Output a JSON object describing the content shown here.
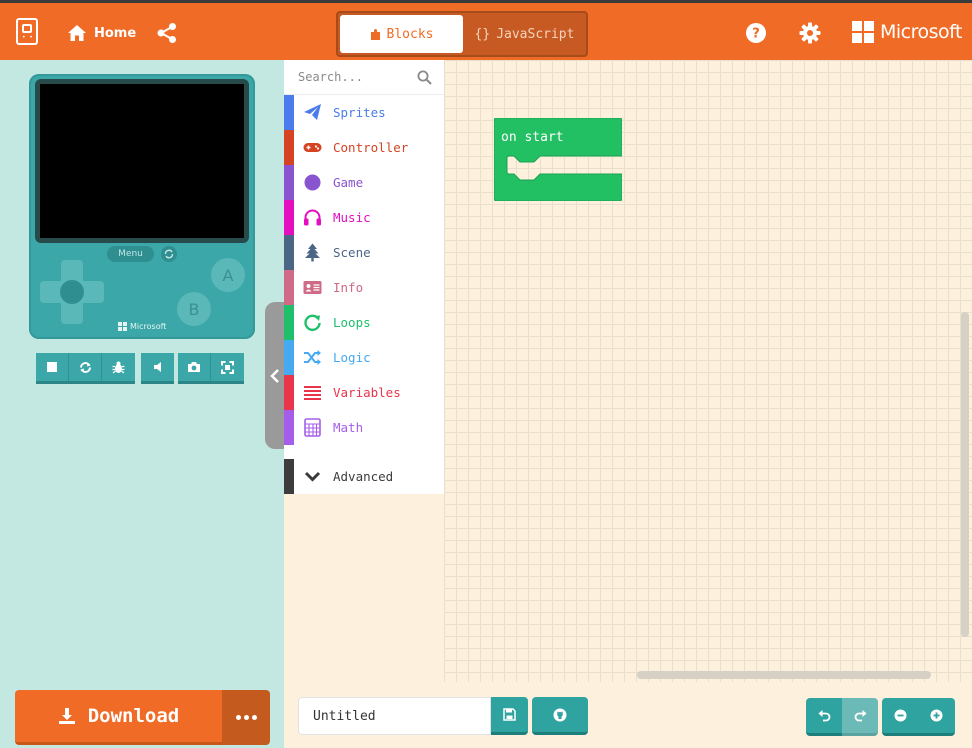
{
  "colors": {
    "brand_orange": "#f06b25",
    "teal": "#3ba7a8",
    "sim_bg": "#c3e8e1",
    "workspace_bg": "#fdf0dc",
    "on_start_green": "#22bf63"
  },
  "header": {
    "home_label": "Home",
    "mode_blocks_label": "Blocks",
    "mode_js_label": "JavaScript",
    "brand_label": "Microsoft",
    "icons": [
      "arcade-logo-icon",
      "home-icon",
      "share-icon",
      "help-icon",
      "settings-icon",
      "microsoft-logo-icon"
    ]
  },
  "simulator": {
    "menu_label": "Menu",
    "button_a": "A",
    "button_b": "B",
    "device_brand": "Microsoft",
    "toolbar_icons": [
      "stop-icon",
      "restart-icon",
      "debug-icon",
      "mute-icon",
      "screenshot-icon",
      "fullscreen-icon"
    ]
  },
  "download": {
    "label": "Download"
  },
  "toolbox": {
    "search_placeholder": "Search...",
    "categories": [
      {
        "label": "Sprites",
        "color": "#4b7bec",
        "icon": "paper-plane-icon"
      },
      {
        "label": "Controller",
        "color": "#d54322",
        "icon": "gamepad-icon"
      },
      {
        "label": "Game",
        "color": "#8854d0",
        "icon": "circle-icon"
      },
      {
        "label": "Music",
        "color": "#e30fc0",
        "icon": "headphones-icon"
      },
      {
        "label": "Scene",
        "color": "#4b6584",
        "icon": "tree-icon"
      },
      {
        "label": "Info",
        "color": "#cf6a87",
        "icon": "id-card-icon"
      },
      {
        "label": "Loops",
        "color": "#20bf6b",
        "icon": "loop-icon"
      },
      {
        "label": "Logic",
        "color": "#45aaf2",
        "icon": "shuffle-icon"
      },
      {
        "label": "Variables",
        "color": "#e8354a",
        "icon": "list-lines-icon"
      },
      {
        "label": "Math",
        "color": "#a55eea",
        "icon": "calculator-icon"
      },
      {
        "label": "Advanced",
        "color": "#3c3c3c",
        "icon": "chevron-down-icon"
      }
    ]
  },
  "workspace": {
    "on_start_label": "on start"
  },
  "bottom": {
    "project_name": "Untitled"
  }
}
